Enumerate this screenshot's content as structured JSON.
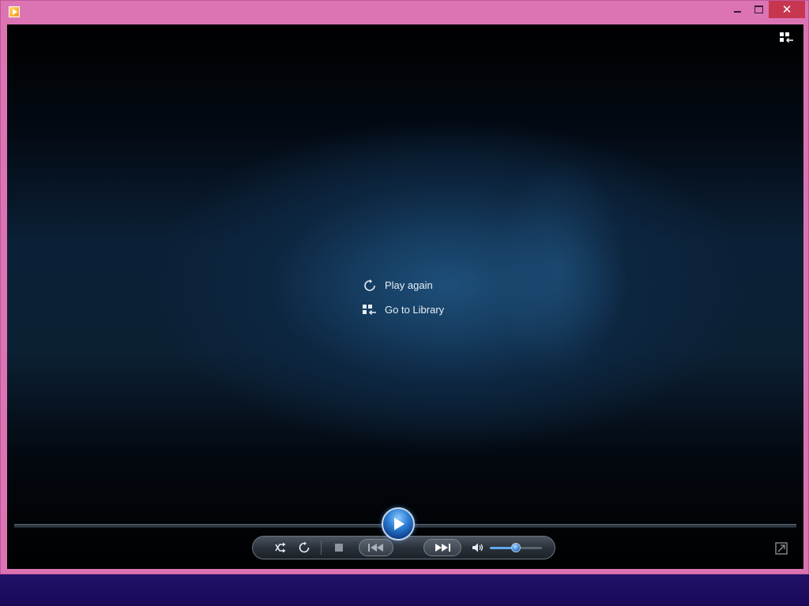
{
  "window": {
    "app_icon": "media-player-app-icon",
    "controls": {
      "minimize_icon": "minimize-icon",
      "maximize_icon": "maximize-icon",
      "close_label": "✕"
    },
    "frame_color": "#dc74b4"
  },
  "header": {
    "switch_to_library_icon": "switch-to-library-icon"
  },
  "overlay_menu": {
    "items": [
      {
        "label": "Play again",
        "icon": "replay-icon"
      },
      {
        "label": "Go to Library",
        "icon": "library-icon"
      }
    ]
  },
  "playback": {
    "progress": 0,
    "buttons": [
      {
        "name": "shuffle",
        "icon": "shuffle-icon"
      },
      {
        "name": "repeat",
        "icon": "repeat-icon"
      },
      {
        "name": "stop",
        "icon": "stop-icon"
      },
      {
        "name": "previous",
        "icon": "previous-icon"
      },
      {
        "name": "play",
        "icon": "play-icon"
      },
      {
        "name": "next",
        "icon": "next-icon"
      },
      {
        "name": "mute",
        "icon": "speaker-icon"
      }
    ],
    "volume_level": 0.5,
    "accent_color": "#2d7fd6"
  },
  "footer": {
    "switch_to_now_playing_icon": "switch-view-icon"
  }
}
